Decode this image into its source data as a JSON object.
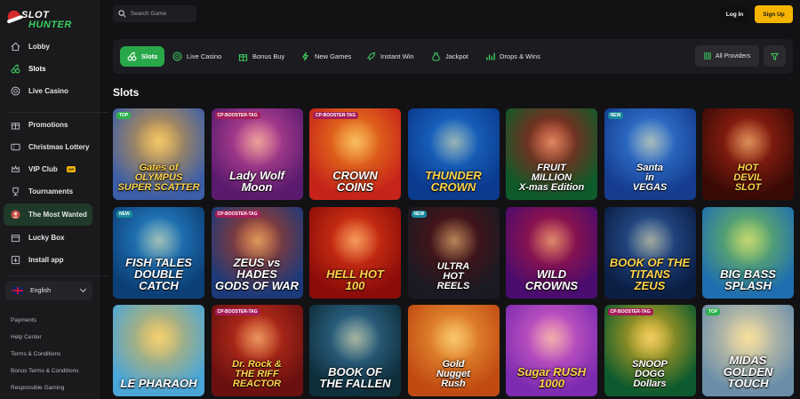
{
  "brand": {
    "line1": "SLOT",
    "line2": "HUNTER"
  },
  "header": {
    "search_placeholder": "Search Game",
    "login_label": "Log In",
    "signup_label": "Sign Up"
  },
  "sidebar": {
    "main": [
      {
        "label": "Lobby",
        "icon": "home-icon"
      },
      {
        "label": "Slots",
        "icon": "cherry-icon",
        "active": true
      },
      {
        "label": "Live Casino",
        "icon": "chip-icon"
      }
    ],
    "secondary": [
      {
        "label": "Promotions",
        "icon": "gift-icon"
      },
      {
        "label": "Christmas Lottery",
        "icon": "ticket-icon"
      },
      {
        "label": "VIP Club",
        "icon": "crown-icon",
        "badge": "VIP"
      },
      {
        "label": "Tournaments",
        "icon": "trophy-icon"
      },
      {
        "label": "The Most Wanted",
        "icon": "avatar-icon",
        "highlight": true
      },
      {
        "label": "Lucky Box",
        "icon": "box-icon"
      },
      {
        "label": "Install app",
        "icon": "download-icon"
      }
    ],
    "language": "English",
    "footer_links": [
      "Payments",
      "Help Center",
      "Terms & Conditions",
      "Bonus Terms & Conditions",
      "Responsible Gaming"
    ]
  },
  "categories": [
    {
      "label": "Slots",
      "icon": "cherry-icon",
      "active": true
    },
    {
      "label": "Live Casino",
      "icon": "chip-icon"
    },
    {
      "label": "Bonus Buy",
      "icon": "gift-icon"
    },
    {
      "label": "New Games",
      "icon": "lightning-icon"
    },
    {
      "label": "Instant Win",
      "icon": "rocket-icon"
    },
    {
      "label": "Jackpot",
      "icon": "moneybag-icon"
    },
    {
      "label": "Drops & Wins",
      "icon": "chart-icon"
    }
  ],
  "providers_label": "All Providers",
  "section_title": "Slots",
  "games": [
    {
      "title": "Gates of\nOLYMPUS\nSUPER SCATTER",
      "tag": "TOP",
      "bg": [
        "#3c5ea8",
        "#e0a035"
      ]
    },
    {
      "title": "Lady Wolf\nMoon",
      "tag": "CP-BOOSTER-TAG",
      "bg": [
        "#5a1b6e",
        "#d24d9c"
      ]
    },
    {
      "title": "CROWN COINS",
      "tag": "CP-BOOSTER-TAG",
      "bg": [
        "#c6241a",
        "#f08a1c"
      ]
    },
    {
      "title": "THUNDER\nCROWN",
      "tag": "",
      "bg": [
        "#0b3a8e",
        "#1d77d8"
      ]
    },
    {
      "title": "FRUIT\nMILLION\nX-mas Edition",
      "tag": "",
      "bg": [
        "#0f5a2a",
        "#b3161b"
      ]
    },
    {
      "title": "Santa\nin\nVEGAS",
      "tag": "NEW",
      "bg": [
        "#153c8e",
        "#3a86e6"
      ]
    },
    {
      "title": "HOT\nDEVIL\nSLOT",
      "tag": "",
      "bg": [
        "#3a0a07",
        "#b02813"
      ]
    },
    {
      "title": "FISH TALES\nDOUBLE CATCH",
      "tag": "NEW",
      "bg": [
        "#0c3f76",
        "#2a8fd8"
      ]
    },
    {
      "title": "ZEUS vs HADES\nGODS OF WAR",
      "tag": "CP-BOOSTER-TAG",
      "bg": [
        "#1c3a7a",
        "#b83b1a"
      ]
    },
    {
      "title": "HELL HOT\n100",
      "tag": "",
      "bg": [
        "#8c0c0a",
        "#e84016"
      ]
    },
    {
      "title": "ULTRA\nHOT\nREELS",
      "tag": "NEW",
      "bg": [
        "#1a1a24",
        "#5c1012"
      ]
    },
    {
      "title": "WILD\nCROWNS",
      "tag": "",
      "bg": [
        "#4a0c6e",
        "#b3163a"
      ]
    },
    {
      "title": "BOOK OF THE TITANS\nZEUS",
      "tag": "",
      "bg": [
        "#0b1e44",
        "#2f5fa8"
      ]
    },
    {
      "title": "BIG BASS\nSPLASH",
      "tag": "",
      "bg": [
        "#1f6fb0",
        "#7ac24a"
      ]
    },
    {
      "title": "LE PHARAOH",
      "tag": "",
      "bg": [
        "#4aa6d8",
        "#e2b64c"
      ]
    },
    {
      "title": "Dr. Rock &\nTHE RIFF\nREACTOR",
      "tag": "CP-BOOSTER-TAG",
      "bg": [
        "#6a1010",
        "#d2361c"
      ]
    },
    {
      "title": "BOOK OF\nTHE FALLEN",
      "tag": "",
      "bg": [
        "#0e2e3a",
        "#3a7aa6"
      ]
    },
    {
      "title": "Gold\nNugget\nRush",
      "tag": "",
      "bg": [
        "#c04a12",
        "#f2a23a"
      ]
    },
    {
      "title": "Sugar RUSH\n1000",
      "tag": "",
      "bg": [
        "#7c2bb0",
        "#e267c8"
      ]
    },
    {
      "title": "SNOOP\nDOGG\nDollars",
      "tag": "CP-BOOSTER-TAG",
      "bg": [
        "#0c5a2e",
        "#e2b020"
      ]
    },
    {
      "title": "MIDAS\nGOLDEN TOUCH",
      "tag": "TOP",
      "bg": [
        "#6a8ea8",
        "#e9d6a6"
      ]
    }
  ]
}
